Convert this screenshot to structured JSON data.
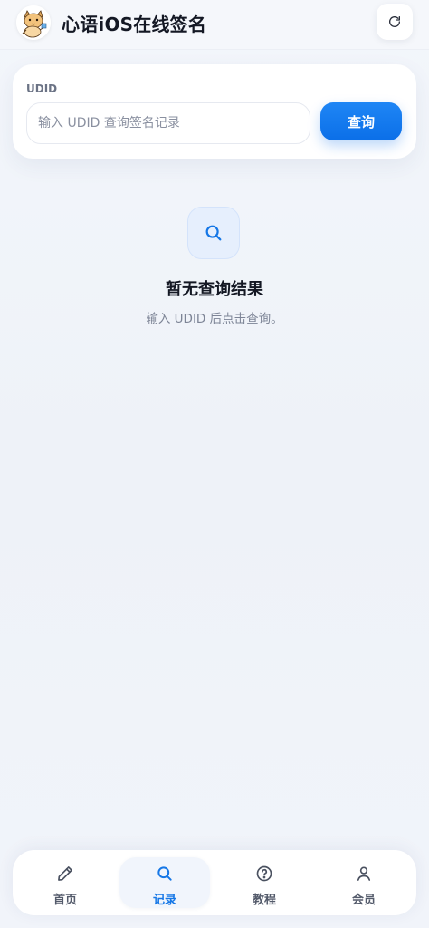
{
  "header": {
    "title": "心语iOS在线签名",
    "logo": "cartoon-cat-logo",
    "refresh_icon": "refresh-icon"
  },
  "query": {
    "label": "UDID",
    "placeholder": "输入 UDID 查询签名记录",
    "value": "",
    "button_label": "查询"
  },
  "empty_state": {
    "icon": "search-icon",
    "title": "暂无查询结果",
    "subtitle": "输入 UDID 后点击查询。"
  },
  "bottom_nav": {
    "items": [
      {
        "label": "首页",
        "icon": "pencil-icon",
        "active": false
      },
      {
        "label": "记录",
        "icon": "search-icon",
        "active": true
      },
      {
        "label": "教程",
        "icon": "help-circle-icon",
        "active": false
      },
      {
        "label": "会员",
        "icon": "user-icon",
        "active": false
      }
    ]
  },
  "colors": {
    "accent": "#0b6fe8",
    "background": "#f1f4fa",
    "text": "#141824",
    "muted": "#7d8496"
  }
}
